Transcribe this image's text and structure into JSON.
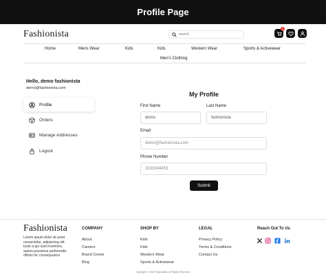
{
  "banner": {
    "title": "Profile Page"
  },
  "header": {
    "logo": "Fashionista",
    "search_placeholder": "search",
    "cart_count": "0"
  },
  "nav": {
    "items": [
      "Home",
      "Mens Wear",
      "Kids",
      "Kids",
      "Western Wear",
      "Sports & Activewear",
      "Men's Clothing"
    ]
  },
  "sidebar": {
    "greeting": "Hello, demo fashionista",
    "email": "demo@fashionista.com",
    "items": [
      {
        "label": "Profile",
        "icon": "user-circle-icon",
        "active": true
      },
      {
        "label": "Orders",
        "icon": "box-icon",
        "active": false
      },
      {
        "label": "Manage Addresses",
        "icon": "id-card-icon",
        "active": false
      },
      {
        "label": "Logout",
        "icon": "lock-icon",
        "active": false
      }
    ]
  },
  "form": {
    "title": "My Profile",
    "first_name_label": "First Name",
    "first_name_value": "demo",
    "last_name_label": "Last Name",
    "last_name_value": "fashionista",
    "email_label": "Email",
    "email_placeholder": "demo@fashionista.com",
    "phone_label": "Phone Number",
    "phone_placeholder": "3333344453",
    "submit_label": "Submit"
  },
  "footer": {
    "logo": "Fashionista",
    "about": "Lorem ipsum dolor sit amet consectetur, adipisicing elit. Iusto a qui sunt inventore, autem possimus perferendis officiis hic consequuntur",
    "company_title": "COMPANY",
    "company_links": [
      "About",
      "Careers",
      "Brand Center",
      "Blog"
    ],
    "shop_title": "SHOP BY",
    "shop_links": [
      "Kids",
      "Kids",
      "Western Wear",
      "Sports & Activewear"
    ],
    "legal_title": "LEGAL",
    "legal_links": [
      "Privacy Policy",
      "Terms & Conditions",
      "Contact Us"
    ],
    "reach_title": "Reach Out To Us",
    "socials": [
      "x-icon",
      "instagram-icon",
      "facebook-icon",
      "linkedin-icon"
    ],
    "copyright": "Copyright © 2024 Fashionista. All Rights Reserved."
  },
  "colors": {
    "accent": "#111111",
    "badge": "#e53935",
    "instagram": "#d62976",
    "facebook": "#1877f2",
    "linkedin": "#0a66c2"
  }
}
